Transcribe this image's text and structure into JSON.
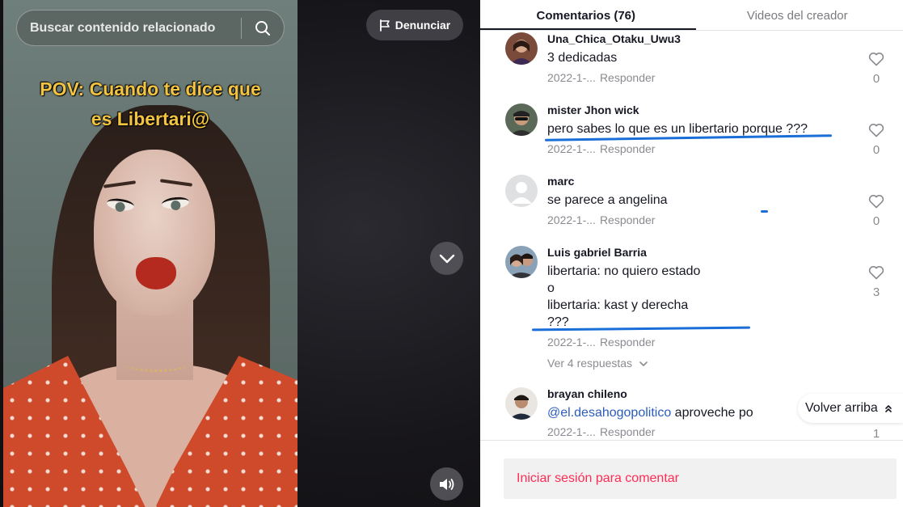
{
  "search": {
    "placeholder": "Buscar contenido relacionado",
    "icon": "search-icon"
  },
  "report_button": {
    "label": "Denunciar",
    "icon": "flag-icon"
  },
  "video": {
    "overlay_line1": "POV: Cuando te dice que",
    "overlay_line2": "es Libertari@",
    "next_icon": "chevron-down-icon",
    "volume_icon": "volume-icon"
  },
  "tabs": [
    {
      "label": "Comentarios (76)",
      "active": true
    },
    {
      "label": "Videos del creador",
      "active": false
    }
  ],
  "comments": [
    {
      "username": "Una_Chica_Otaku_Uwu3",
      "lines": [
        "3 dedicadas"
      ],
      "date": "2022-1-...",
      "reply_label": "Responder",
      "likes": "0"
    },
    {
      "username": "mister Jhon wick",
      "lines": [
        "pero sabes lo que es un libertario porque ???"
      ],
      "date": "2022-1-...",
      "reply_label": "Responder",
      "likes": "0"
    },
    {
      "username": "marc",
      "lines": [
        "se parece a angelina"
      ],
      "date": "2022-1-...",
      "reply_label": "Responder",
      "likes": "0"
    },
    {
      "username": "Luis gabriel Barria",
      "lines": [
        "libertaria: no quiero estado",
        "o",
        "libertaria: kast y derecha",
        "???"
      ],
      "date": "2022-1-...",
      "reply_label": "Responder",
      "likes": "3",
      "replies_link": "Ver 4 respuestas"
    },
    {
      "username": "brayan chileno",
      "mention": "@el.desahogopolitico",
      "text_after_mention": " aproveche po",
      "date": "2022-1-...",
      "reply_label": "Responder",
      "likes": "1"
    }
  ],
  "back_to_top": {
    "label": "Volver arriba",
    "icon": "double-chevron-up-icon"
  },
  "login": {
    "label": "Iniciar sesión para comentar"
  },
  "colors": {
    "accent": "#fe2c55",
    "mention": "#2b5db9",
    "annotation": "#1a6ed8",
    "overlay_text": "#f3c442"
  }
}
